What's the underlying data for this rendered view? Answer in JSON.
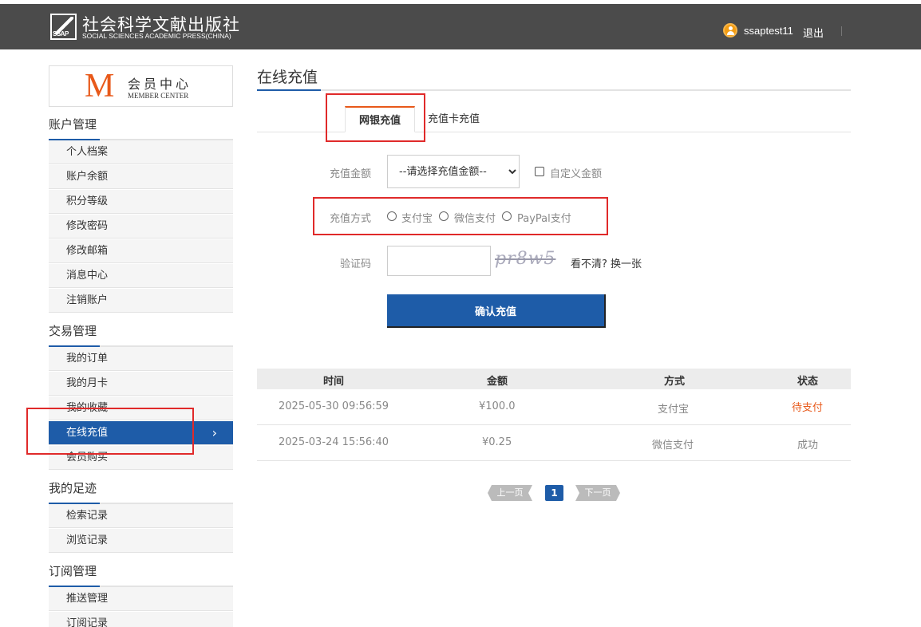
{
  "header": {
    "brand_cn": "社会科学文献出版社",
    "brand_en": "SOCIAL SCIENCES ACADEMIC PRESS(CHINA)",
    "logo_text": "SSAP",
    "username": "ssaptest11",
    "logout": "退出"
  },
  "member_center": {
    "m": "M",
    "cn": "会员中心",
    "en": "MEMBER CENTER"
  },
  "sidebar": {
    "sections": [
      {
        "title": "账户管理",
        "items": [
          "个人档案",
          "账户余额",
          "积分等级",
          "修改密码",
          "修改邮箱",
          "消息中心",
          "注销账户"
        ]
      },
      {
        "title": "交易管理",
        "items": [
          "我的订单",
          "我的月卡",
          "我的收藏",
          "在线充值",
          "会员购买"
        ]
      },
      {
        "title": "我的足迹",
        "items": [
          "检索记录",
          "浏览记录"
        ]
      },
      {
        "title": "订阅管理",
        "items": [
          "推送管理",
          "订阅记录"
        ]
      }
    ],
    "active_chevron": "›"
  },
  "main": {
    "title": "在线充值",
    "tabs": [
      "网银充值",
      "充值卡充值"
    ],
    "form": {
      "amount_label": "充值金额",
      "amount_select": "--请选择充值金额--",
      "custom_amount": "自定义金额",
      "method_label": "充值方式",
      "methods": [
        "支付宝",
        "微信支付",
        "PayPal支付"
      ],
      "captcha_label": "验证码",
      "captcha_image_text": "pr8w5",
      "refresh": "看不清? 换一张",
      "confirm": "确认充值"
    },
    "table": {
      "headers": [
        "时间",
        "金额",
        "方式",
        "状态"
      ],
      "rows": [
        [
          "2025-05-30 09:56:59",
          "¥100.0",
          "支付宝",
          "待支付"
        ],
        [
          "2025-03-24 15:56:40",
          "¥0.25",
          "微信支付",
          "成功"
        ]
      ]
    },
    "pager": {
      "prev": "上一页",
      "current": "1",
      "next": "下一页"
    }
  },
  "colors": {
    "header_bg": "#4b4b4b",
    "accent_blue": "#1e5ca8",
    "accent_orange": "#e8591a",
    "annotation_red": "#e02a2a"
  }
}
